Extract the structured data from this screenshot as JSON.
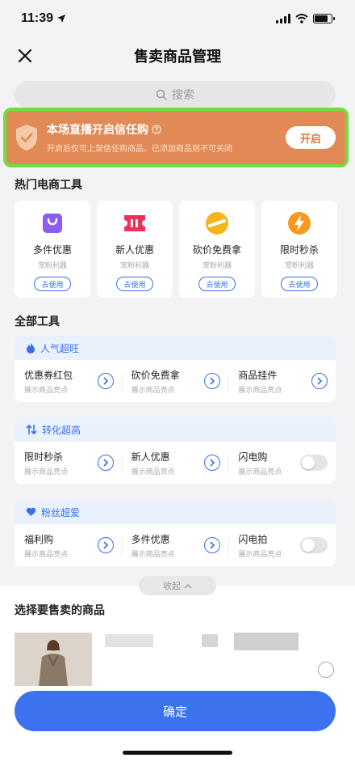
{
  "status": {
    "time": "11:39"
  },
  "nav": {
    "title": "售卖商品管理"
  },
  "search": {
    "placeholder": "搜索"
  },
  "trust_banner": {
    "title": "本场直播开启信任购",
    "subtitle": "开启后仅可上架信任购商品，已添加商品则不可关闭",
    "button": "开启",
    "color": "#e28a55",
    "highlight_color": "#6ee03c"
  },
  "hot_tools": {
    "title": "热门电商工具",
    "items": [
      {
        "name": "多件优惠",
        "sub": "宠粉利器",
        "button": "去使用",
        "icon": "shopping-bag-icon",
        "color": "#8a5cf0"
      },
      {
        "name": "新人优惠",
        "sub": "宠粉利器",
        "button": "去使用",
        "icon": "ticket-icon",
        "color": "#f0305a"
      },
      {
        "name": "砍价免费拿",
        "sub": "宠粉利器",
        "button": "去使用",
        "icon": "coin-icon",
        "color": "#f5b51e"
      },
      {
        "name": "限时秒杀",
        "sub": "宠粉利器",
        "button": "去使用",
        "icon": "lightning-icon",
        "color": "#f59a1e"
      }
    ]
  },
  "all_tools": {
    "title": "全部工具",
    "groups": [
      {
        "title": "人气超旺",
        "icon": "flame-icon",
        "items": [
          {
            "name": "优惠券红包",
            "sub": "展示商品亮点",
            "control": "arrow"
          },
          {
            "name": "砍价免费拿",
            "sub": "展示商品亮点",
            "control": "arrow"
          },
          {
            "name": "商品挂件",
            "sub": "展示商品亮点",
            "control": "arrow"
          }
        ]
      },
      {
        "title": "转化超高",
        "icon": "updown-arrows-icon",
        "items": [
          {
            "name": "限时秒杀",
            "sub": "展示商品亮点",
            "control": "arrow"
          },
          {
            "name": "新人优惠",
            "sub": "展示商品亮点",
            "control": "arrow"
          },
          {
            "name": "闪电购",
            "sub": "展示商品亮点",
            "control": "toggle",
            "on": false
          }
        ]
      },
      {
        "title": "粉丝超爱",
        "icon": "heart-icon",
        "items": [
          {
            "name": "福利购",
            "sub": "展示商品亮点",
            "control": "arrow"
          },
          {
            "name": "多件优惠",
            "sub": "展示商品亮点",
            "control": "arrow"
          },
          {
            "name": "闪电拍",
            "sub": "展示商品亮点",
            "control": "toggle",
            "on": false
          }
        ]
      }
    ]
  },
  "collapse": {
    "label": "收起"
  },
  "products": {
    "title": "选择要售卖的商品"
  },
  "confirm": {
    "label": "确定",
    "color": "#3c72ee"
  },
  "accent_color": "#3a6fe8"
}
